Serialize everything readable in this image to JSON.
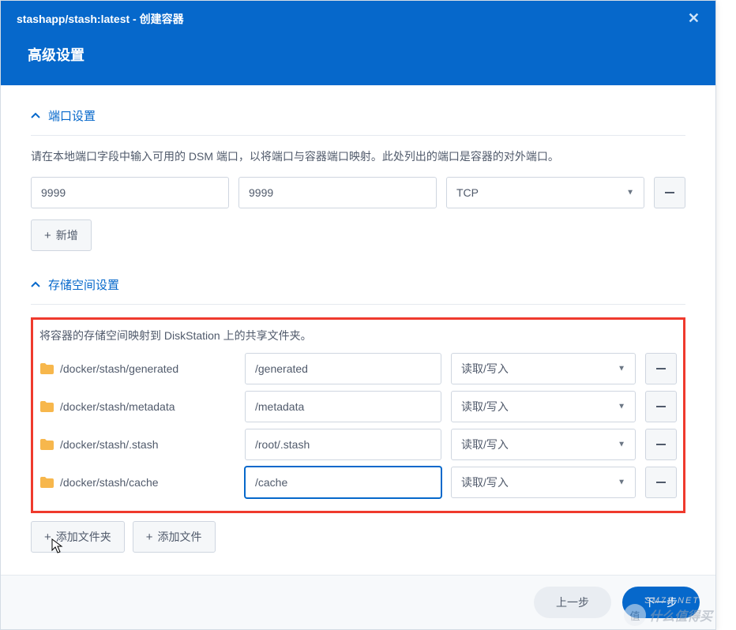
{
  "header": {
    "breadcrumb": "stashapp/stash:latest - 创建容器",
    "title": "高级设置"
  },
  "port_section": {
    "title": "端口设置",
    "desc": "请在本地端口字段中输入可用的 DSM 端口，以将端口与容器端口映射。此处列出的端口是容器的对外端口。",
    "local": "9999",
    "container": "9999",
    "protocol": "TCP",
    "add_label": "新增"
  },
  "storage_section": {
    "title": "存储空间设置",
    "desc": "将容器的存储空间映射到 DiskStation 上的共享文件夹。",
    "rows": [
      {
        "host": "/docker/stash/generated",
        "container": "/generated",
        "mode": "读取/写入"
      },
      {
        "host": "/docker/stash/metadata",
        "container": "/metadata",
        "mode": "读取/写入"
      },
      {
        "host": "/docker/stash/.stash",
        "container": "/root/.stash",
        "mode": "读取/写入"
      },
      {
        "host": "/docker/stash/cache",
        "container": "/cache",
        "mode": "读取/写入"
      }
    ],
    "add_folder_label": "添加文件夹",
    "add_file_label": "添加文件"
  },
  "footer": {
    "prev": "上一步",
    "next": "下一步"
  },
  "watermark": {
    "char": "值",
    "text": "什么值得买"
  }
}
